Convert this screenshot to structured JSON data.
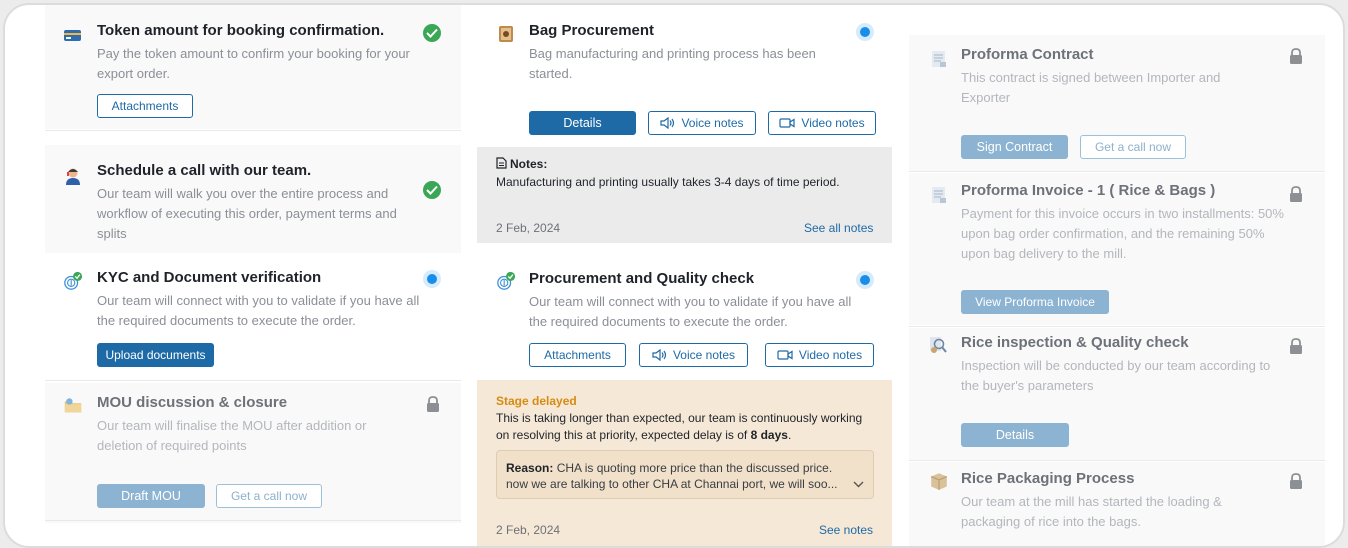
{
  "col1": {
    "token": {
      "title": "Token amount for booking confirmation.",
      "desc": "Pay the token amount to confirm your booking for your export order.",
      "attachments": "Attachments"
    },
    "schedule": {
      "title": "Schedule a call with our team.",
      "desc": "Our team will walk you over the entire process and workflow of executing this order, payment terms and splits"
    },
    "kyc": {
      "title": "KYC and Document verification",
      "desc": "Our team will connect with you to validate if you have all the required documents to execute the order.",
      "upload": "Upload documents"
    },
    "mou": {
      "title": "MOU discussion & closure",
      "desc": "Our team will finalise the MOU after addition or deletion of required points",
      "draft": "Draft MOU",
      "call": "Get a call now"
    }
  },
  "col2": {
    "bag": {
      "title": "Bag Procurement",
      "desc": "Bag manufacturing and printing process has been started.",
      "details": "Details",
      "voice": "Voice notes",
      "video": "Video notes",
      "notes_label": "Notes:",
      "notes_text": "Manufacturing and printing usually takes 3-4 days of time period.",
      "date": "2 Feb, 2024",
      "see_all": "See all notes"
    },
    "quality": {
      "title": "Procurement and Quality check",
      "desc": "Our team will connect with you to validate if you have all the required documents to execute the order.",
      "attachments": "Attachments",
      "voice": "Voice notes",
      "video": "Video notes",
      "delay_label": "Stage delayed",
      "delay_text_1": "This is taking longer than expected, our team is continuously working",
      "delay_text_2": "on resolving this at priority, expected delay is of",
      "delay_days": "8 days",
      "delay_period": ".",
      "reason_label": "Reason:",
      "reason_text_1": "CHA is quoting more price than the discussed price.",
      "reason_text_2": "now we are talking to other CHA at Channai port, we will soo...",
      "date": "2 Feb, 2024",
      "see": "See notes"
    }
  },
  "col3": {
    "contract": {
      "title": "Proforma Contract",
      "desc": "This contract is signed between Importer and Exporter",
      "sign": "Sign Contract",
      "call": "Get a call now"
    },
    "invoice": {
      "title": "Proforma Invoice - 1 ( Rice & Bags )",
      "desc": "Payment for this invoice occurs in two installments: 50% upon bag order confirmation, and the remaining 50% upon bag delivery to the mill.",
      "view": "View Proforma Invoice"
    },
    "inspection": {
      "title": "Rice inspection & Quality check",
      "desc": "Inspection will be conducted by our team according to the buyer's parameters",
      "details": "Details"
    },
    "packaging": {
      "title": "Rice Packaging Process",
      "desc": "Our team at the mill has started the loading & packaging of rice into the bags."
    }
  },
  "colors": {
    "accent": "#1e6aa6",
    "success": "#3aa757",
    "active": "#1a8de8",
    "delay": "#d68b12"
  },
  "icons": [
    "card-icon",
    "support-agent-icon",
    "fingerprint-verified-icon",
    "folder-icon",
    "bag-icon",
    "document-icon",
    "inspection-icon",
    "box-icon",
    "check-icon",
    "active-dot-icon",
    "lock-icon",
    "speaker-icon",
    "video-icon",
    "chevron-down-icon"
  ]
}
